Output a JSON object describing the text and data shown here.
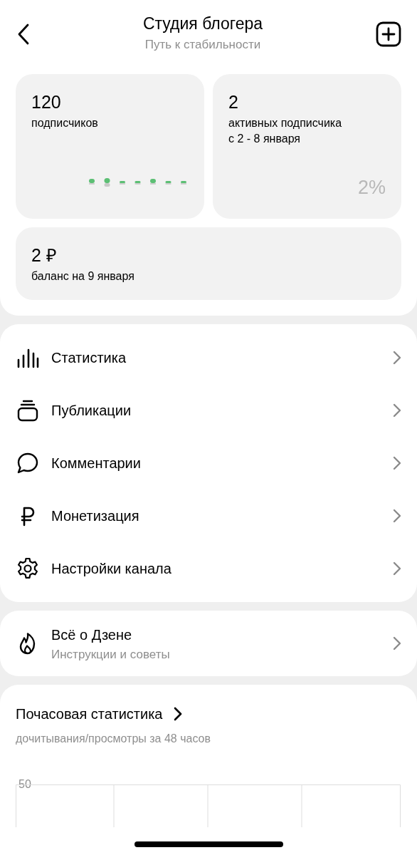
{
  "header": {
    "title": "Студия блогера",
    "subtitle": "Путь к стабильности"
  },
  "stats": [
    {
      "value": "120",
      "label": "подписчиков",
      "kind": "sparkline"
    },
    {
      "value": "2",
      "label": "активных подписчика\nс 2 - 8 января",
      "kind": "percent",
      "percent": "2%"
    }
  ],
  "balance": {
    "value": "2 ₽",
    "label": "баланс на 9 января"
  },
  "menu": [
    {
      "label": "Статистика",
      "kind": "bars"
    },
    {
      "label": "Публикации",
      "kind": "stack"
    },
    {
      "label": "Комментарии",
      "kind": "bubble"
    },
    {
      "label": "Монетизация",
      "kind": "ruble"
    },
    {
      "label": "Настройки канала",
      "kind": "gear"
    }
  ],
  "about": {
    "title": "Всё о Дзене",
    "subtitle": "Инструкции и советы"
  },
  "hourly": {
    "title": "Почасовая статистика",
    "subtitle": "дочитывания/просмотры за 48 часов",
    "tick": "50"
  }
}
